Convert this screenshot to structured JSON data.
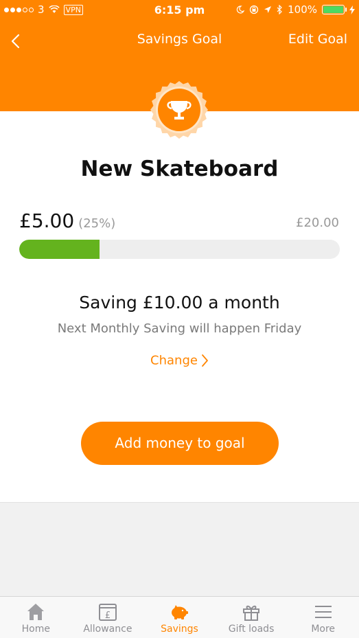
{
  "status_bar": {
    "carrier": "3",
    "vpn": "VPN",
    "time": "6:15 pm",
    "battery": "100%",
    "signal_dots_filled": 3,
    "signal_dots_total": 5,
    "battery_level": 1.0
  },
  "nav": {
    "title": "Savings Goal",
    "edit_label": "Edit Goal"
  },
  "goal": {
    "name": "New Skateboard",
    "saved": "£5.00",
    "percent_text": "(25%)",
    "target": "£20.00",
    "progress": 0.25,
    "rate_text": "Saving £10.00 a month",
    "next_text": "Next Monthly Saving will happen Friday",
    "change_label": "Change",
    "add_button": "Add money to goal"
  },
  "tabs": [
    {
      "label": "Home",
      "icon": "home-icon",
      "active": false
    },
    {
      "label": "Allowance",
      "icon": "calendar-pound-icon",
      "active": false
    },
    {
      "label": "Savings",
      "icon": "piggy-bank-icon",
      "active": true
    },
    {
      "label": "Gift loads",
      "icon": "gift-icon",
      "active": false
    },
    {
      "label": "More",
      "icon": "menu-icon",
      "active": false
    }
  ],
  "colors": {
    "accent": "#ff8500",
    "progress": "#64b31e",
    "track": "#eeeeee",
    "tab_inactive": "#8e8e93"
  }
}
